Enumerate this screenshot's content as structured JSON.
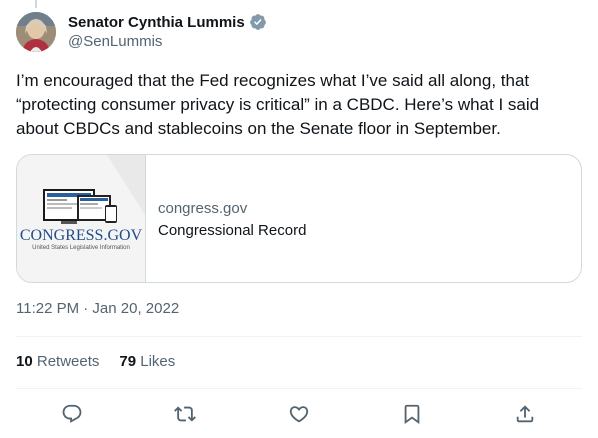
{
  "author": {
    "display_name": "Senator Cynthia Lummis",
    "handle": "@SenLummis",
    "verified": true
  },
  "tweet": {
    "text": "I’m encouraged that the Fed recognizes what I’ve said all along, that “protecting consumer privacy is critical” in a CBDC. Here’s what I said about CBDCs and stablecoins on the Senate floor in September.",
    "timestamp": "11:22 PM · Jan 20, 2022"
  },
  "card": {
    "logo_text": "CONGRESS.GOV",
    "logo_subtitle": "United States Legislative Information",
    "domain": "congress.gov",
    "title": "Congressional Record"
  },
  "stats": {
    "retweets_count": "10",
    "retweets_label": "Retweets",
    "likes_count": "79",
    "likes_label": "Likes"
  },
  "colors": {
    "verified": "#829aab",
    "secondary_text": "#536471",
    "border": "#cfd9de"
  },
  "icons": [
    "reply-icon",
    "retweet-icon",
    "like-icon",
    "bookmark-icon",
    "share-icon"
  ]
}
